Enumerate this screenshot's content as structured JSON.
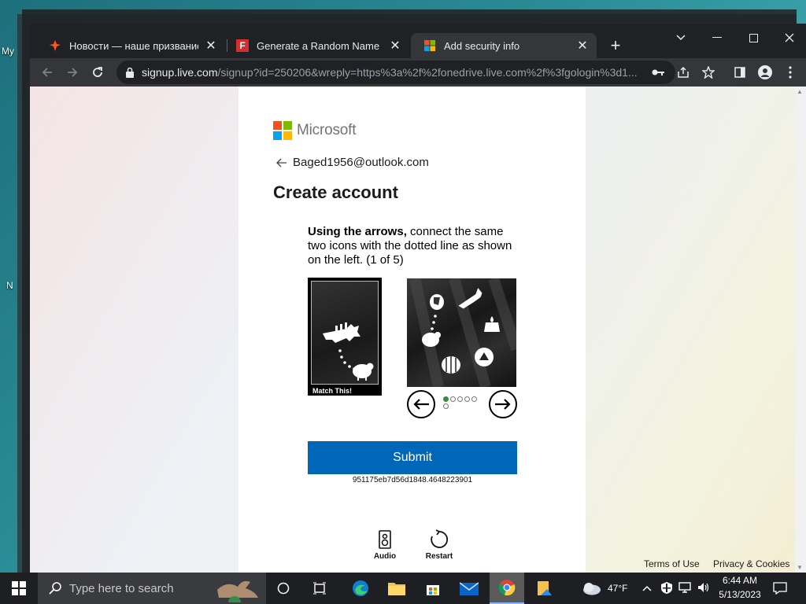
{
  "desktop": {
    "labels": [
      "My",
      "N"
    ]
  },
  "browser": {
    "tabs": [
      {
        "title": "Новости — наше призвание на",
        "close": "✕",
        "favicon": "news-favicon"
      },
      {
        "title": "Generate a Random Name - Fake",
        "close": "✕",
        "favicon": "F"
      },
      {
        "title": "Add security info",
        "close": "✕",
        "favicon": "microsoft-favicon"
      }
    ],
    "new_tab": "+",
    "window_controls": {
      "dropdown": "⌄",
      "minimize": "—",
      "maximize": "☐",
      "close": "✕"
    },
    "url": {
      "domain": "signup.live.com",
      "path": "/signup?id=250206&wreply=https%3a%2f%2fonedrive.live.com%2f%3fgologin%3d1..."
    }
  },
  "page": {
    "brand": "Microsoft",
    "back_email": "Baged1956@outlook.com",
    "heading": "Create account",
    "captcha": {
      "instruction_bold": "Using the arrows,",
      "instruction_rest": " connect the same two icons with the dotted line as shown on the left. (1 of 5)",
      "sample_label": "Match This!",
      "progress_total": 6,
      "progress_active": 0,
      "submit_label": "Submit",
      "token": "951175eb7d56d1848.4648223901",
      "audio_label": "Audio",
      "restart_label": "Restart"
    },
    "footer": {
      "terms": "Terms of Use",
      "privacy": "Privacy & Cookies"
    }
  },
  "taskbar": {
    "search_placeholder": "Type here to search",
    "weather": "47°F",
    "time": "6:44 AM",
    "date": "5/13/2023"
  },
  "colors": {
    "accent": "#0067b8",
    "ms_red": "#f25022",
    "ms_green": "#7fba00",
    "ms_blue": "#00a4ef",
    "ms_yellow": "#ffb900"
  }
}
